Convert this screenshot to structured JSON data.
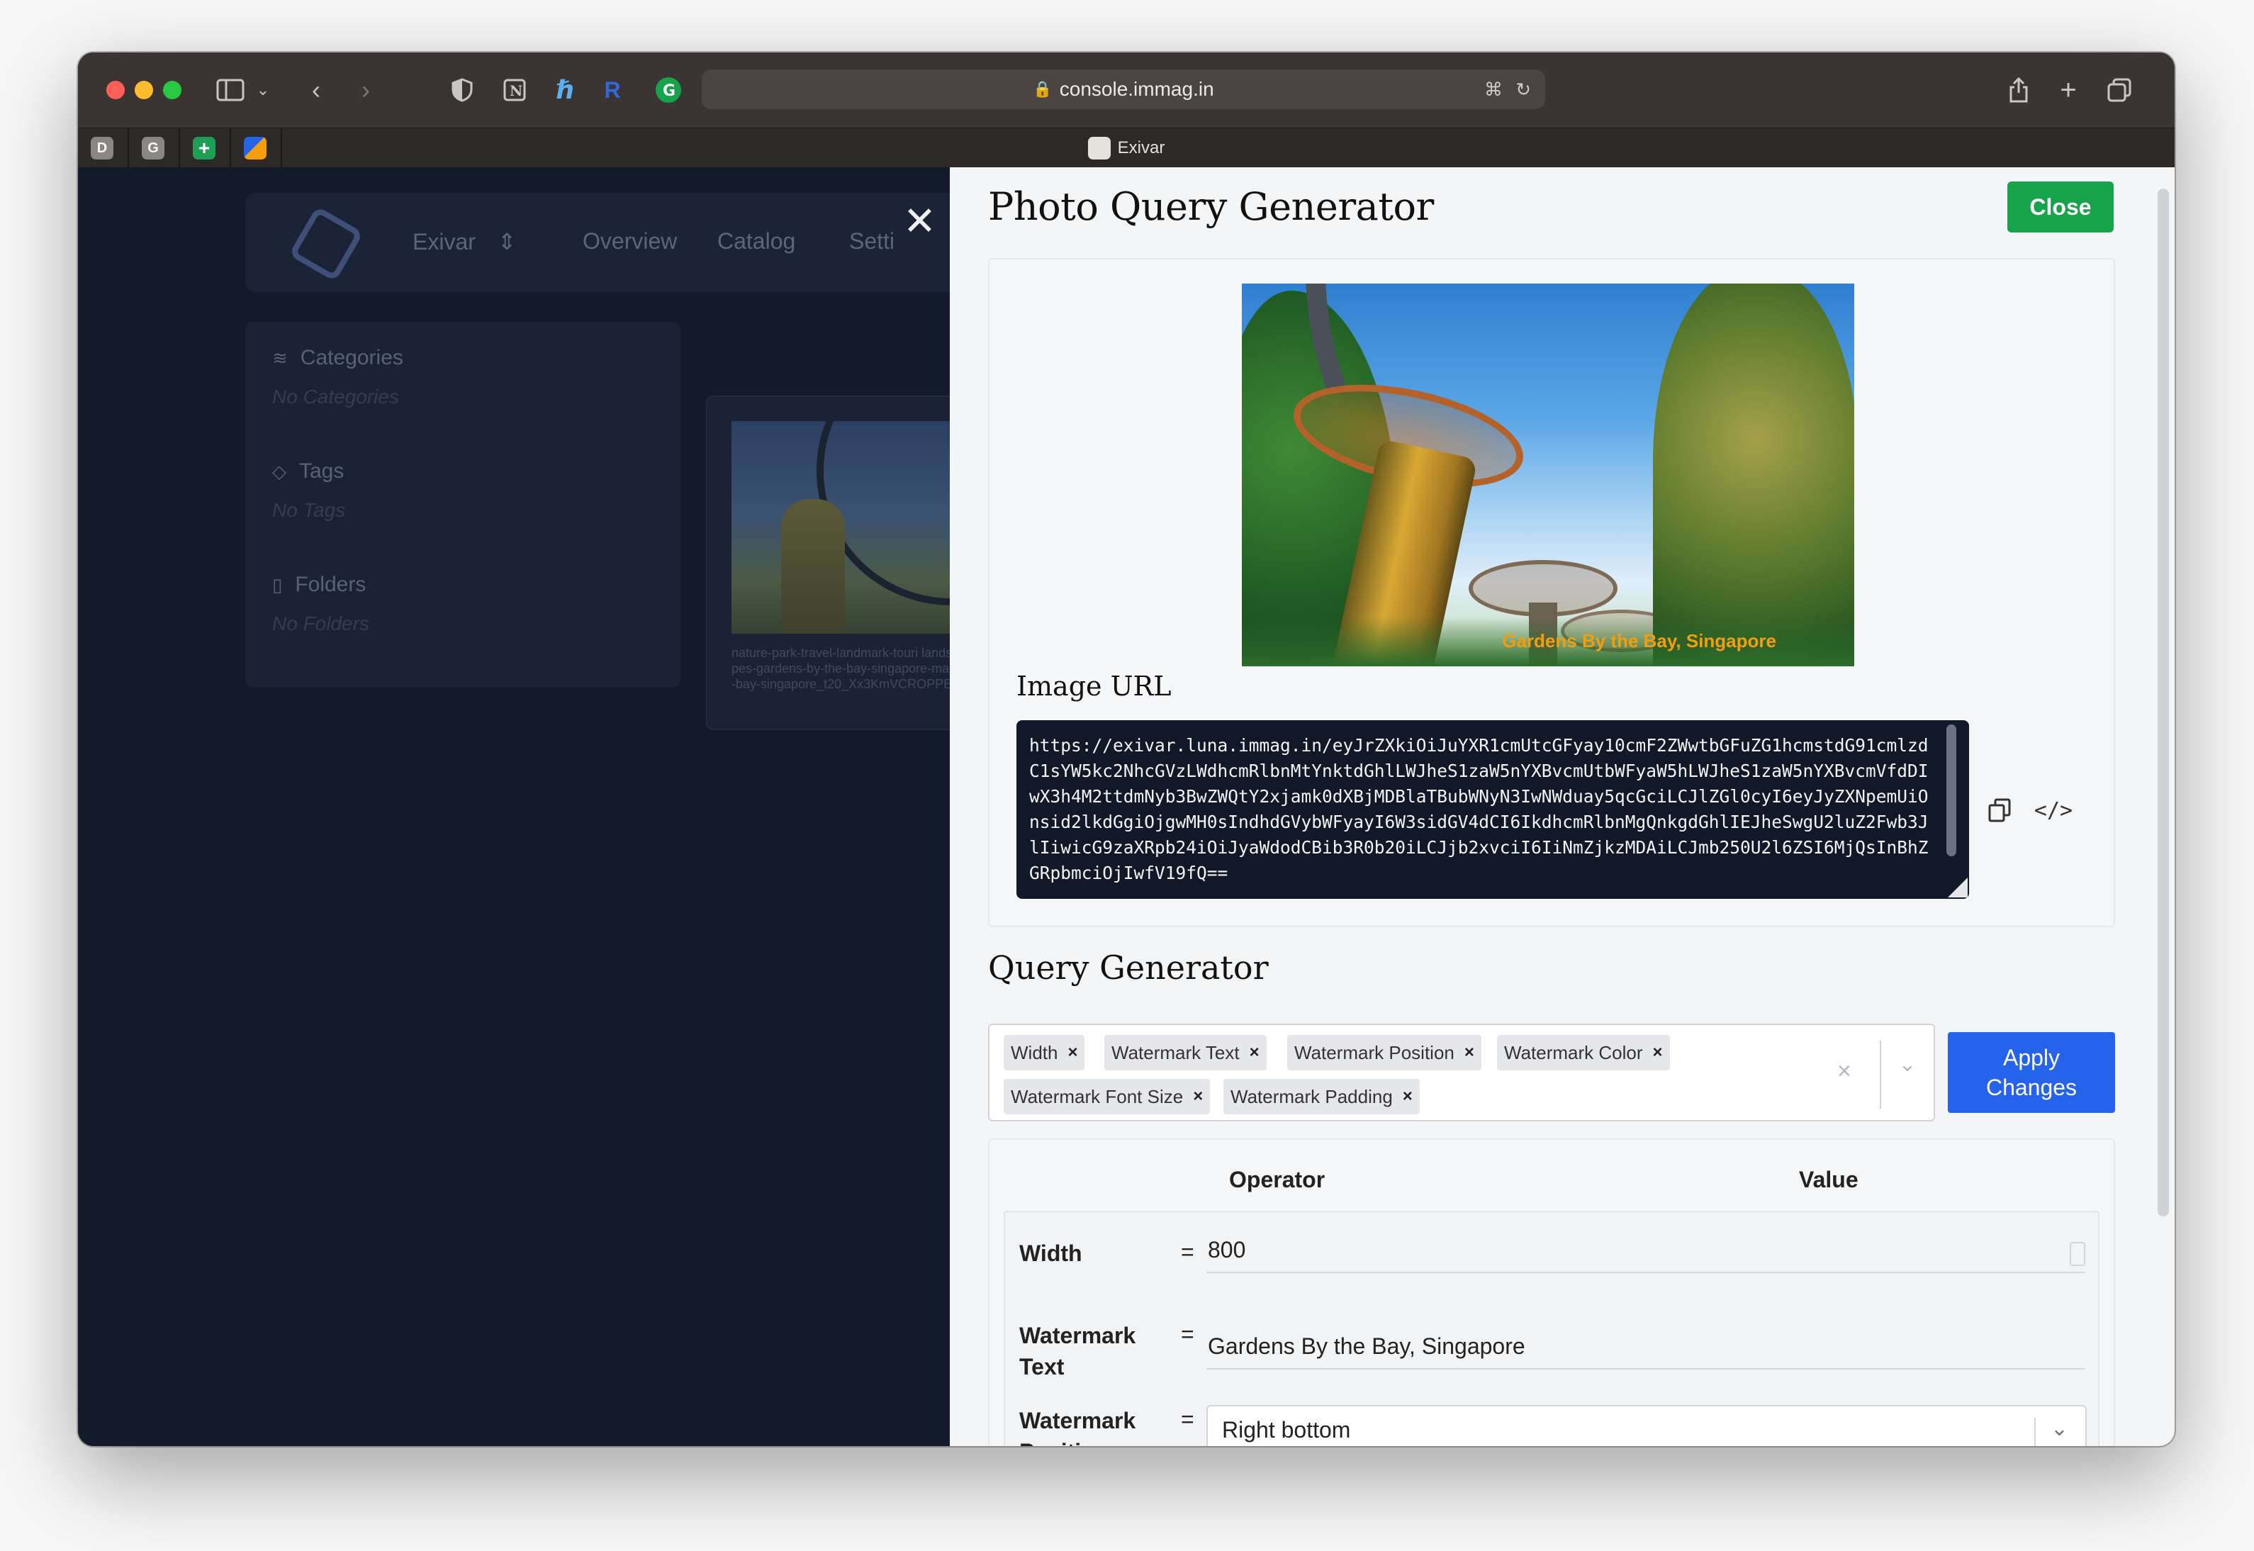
{
  "browser": {
    "url": "console.immag.in",
    "active_tab_title": "Exivar",
    "pinned_tabs": [
      "D",
      "G",
      "+",
      ""
    ]
  },
  "background_app": {
    "workspace": "Exivar",
    "nav": [
      "Overview",
      "Catalog",
      "Setti"
    ],
    "sections": [
      {
        "title": "Categories",
        "empty": "No Categories"
      },
      {
        "title": "Tags",
        "empty": "No Tags"
      },
      {
        "title": "Folders",
        "empty": "No Folders"
      }
    ],
    "card_filename": "nature-park-travel-landmark-touri landscapes-gardens-by-the-bay-singapore-marina-bay-singapore_t20_Xx3KmVCROPPED"
  },
  "panel": {
    "title": "Photo Query Generator",
    "close_label": "Close",
    "photo_watermark": "Gardens By the Bay, Singapore",
    "image_url_label": "Image URL",
    "image_url": "https://exivar.luna.immag.in/eyJrZXkiOiJuYXR1cmUtcGFyay10cmF2ZWwtbGFuZG1hcmstdG91cmlzdC1sYW5kc2NhcGVzLWdhcmRlbnMtYnktdGhlLWJheS1zaW5nYXBvcmUtbWFyaW5hLWJheS1zaW5nYXBvcmVfdDIwX3h4M2ttdmNyb3BwZWQtY2xjamk0dXBjMDBlaTBubWNyN3IwNWduay5qcGciLCJlZGl0cyI6eyJyZXNpemUiOnsid2lkdGgiOjgwMH0sIndhdGVybWFyayI6W3sidGV4dCI6IkdhcmRlbnMgQnkgdGhlIEJheSwgU2luZ2Fwb3JlIiwicG9zaXRpb24iOiJyaWdodCBib3R0b20iLCJjb2xvciI6IiNmZjkzMDAiLCJmb250U2l6ZSI6MjQsInBhZGRpbmciOjIwfV19fQ==",
    "query_generator_title": "Query Generator",
    "chips": [
      "Width",
      "Watermark Text",
      "Watermark Position",
      "Watermark Color",
      "Watermark Font Size",
      "Watermark Padding"
    ],
    "apply_label": "Apply\nChanges",
    "table_headers": {
      "operator": "Operator",
      "value": "Value"
    },
    "rows": [
      {
        "label": "Width",
        "op": "=",
        "value": "800"
      },
      {
        "label": "Watermark Text",
        "op": "=",
        "value": "Gardens By the Bay, Singapore"
      },
      {
        "label": "Watermark Position",
        "op": "=",
        "value": "Right bottom"
      }
    ]
  },
  "colors": {
    "close_button": "#16a34a",
    "apply_button": "#2563eb",
    "watermark": "#f59e0b",
    "code_bg": "#111827"
  }
}
